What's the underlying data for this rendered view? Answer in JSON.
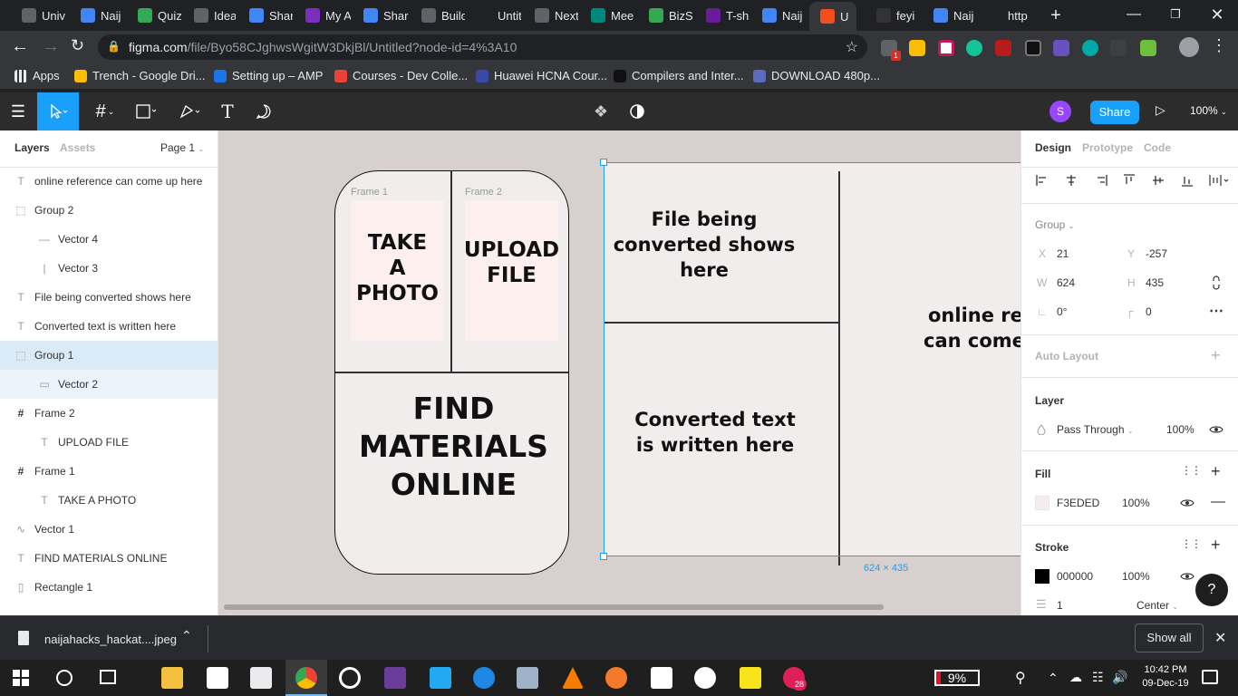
{
  "browser": {
    "tabs": [
      {
        "label": "Univ",
        "color": "#5f6368"
      },
      {
        "label": "Naij",
        "color": "#4285f4"
      },
      {
        "label": "Quiz",
        "color": "#34a853"
      },
      {
        "label": "Idea",
        "color": "#5f6368"
      },
      {
        "label": "Shar",
        "color": "#4285f4"
      },
      {
        "label": "My A",
        "color": "#7b2fbe"
      },
      {
        "label": "Shar",
        "color": "#4285f4"
      },
      {
        "label": "Build",
        "color": "#5f6368"
      },
      {
        "label": "Untit",
        "color": "#202124"
      },
      {
        "label": "Next",
        "color": "#5f6368"
      },
      {
        "label": "Mee",
        "color": "#00897b"
      },
      {
        "label": "BizS",
        "color": "#34a853"
      },
      {
        "label": "T-sh",
        "color": "#6a1b9a"
      },
      {
        "label": "Naij",
        "color": "#4285f4"
      },
      {
        "label": "U",
        "color": "#f24e1e"
      },
      {
        "label": "feyi",
        "color": "#333"
      },
      {
        "label": "Naij",
        "color": "#4285f4"
      },
      {
        "label": "",
        "color": "#202124"
      },
      {
        "label": "http",
        "color": "#202124"
      }
    ],
    "url_host": "figma.com",
    "url_path": "/file/Byo58CJghwsWgitW3DkjBl/Untitled?node-id=4%3A10",
    "bookmarks": [
      {
        "label": "Apps",
        "color": "#e8eaed"
      },
      {
        "label": "Trench - Google Dri...",
        "color": "#fbbc04"
      },
      {
        "label": "Setting up – AMP",
        "color": "#1a73e8"
      },
      {
        "label": "Courses - Dev Colle...",
        "color": "#ea4335"
      },
      {
        "label": "Huawei HCNA Cour...",
        "color": "#3949ab"
      },
      {
        "label": "Compilers and Inter...",
        "color": "#111"
      },
      {
        "label": "DOWNLOAD 480p...",
        "color": "#5c6bc0"
      }
    ],
    "ext_badge": "1"
  },
  "figma": {
    "avatar_letter": "S",
    "share_label": "Share",
    "zoom": "100%",
    "layers_tab": "Layers",
    "assets_tab": "Assets",
    "page_label": "Page 1",
    "layers": [
      {
        "label": "online reference can come up here",
        "icon": "T",
        "indent": 0
      },
      {
        "label": "Group 2",
        "icon": "⬚",
        "indent": 0
      },
      {
        "label": "Vector 4",
        "icon": "—",
        "indent": 1
      },
      {
        "label": "Vector 3",
        "icon": "|",
        "indent": 1
      },
      {
        "label": "File being converted shows here",
        "icon": "T",
        "indent": 0
      },
      {
        "label": "Converted text is written here",
        "icon": "T",
        "indent": 0
      },
      {
        "label": "Group 1",
        "icon": "⬚",
        "indent": 0
      },
      {
        "label": "Vector 2",
        "icon": "▭",
        "indent": 1
      },
      {
        "label": "Frame 2",
        "icon": "#",
        "indent": 0
      },
      {
        "label": "UPLOAD FILE",
        "icon": "T",
        "indent": 1
      },
      {
        "label": "Frame 1",
        "icon": "#",
        "indent": 0
      },
      {
        "label": "TAKE A PHOTO",
        "icon": "T",
        "indent": 1
      },
      {
        "label": "Vector 1",
        "icon": "∿",
        "indent": 0
      },
      {
        "label": "FIND MATERIALS ONLINE",
        "icon": "T",
        "indent": 0
      },
      {
        "label": "Rectangle 1",
        "icon": "▯",
        "indent": 0
      }
    ],
    "canvas": {
      "frame1_label": "Frame 1",
      "frame2_label": "Frame 2",
      "take_photo": [
        "TAKE",
        "A",
        "PHOTO"
      ],
      "upload_file": [
        "UPLOAD",
        "FILE"
      ],
      "find_materials": [
        "FIND",
        "MATERIALS",
        "ONLINE"
      ],
      "file_converted": [
        "File being",
        "converted shows",
        "here"
      ],
      "converted_text": [
        "Converted text",
        "is written here"
      ],
      "online_ref": [
        "online ref",
        "can come"
      ],
      "dimension": "624 × 435"
    },
    "design": {
      "tabs": [
        "Design",
        "Prototype",
        "Code"
      ],
      "group_label": "Group",
      "x_label": "X",
      "x_value": "21",
      "y_label": "Y",
      "y_value": "-257",
      "w_label": "W",
      "w_value": "624",
      "h_label": "H",
      "h_value": "435",
      "rotation": "0°",
      "radius": "0",
      "auto_layout": "Auto Layout",
      "layer_title": "Layer",
      "blend_mode": "Pass Through",
      "layer_opacity": "100%",
      "fill_title": "Fill",
      "fill_hex": "F3EDED",
      "fill_color": "#F3EDED",
      "fill_opacity": "100%",
      "stroke_title": "Stroke",
      "stroke_hex": "000000",
      "stroke_color": "#000000",
      "stroke_opacity": "100%",
      "stroke_weight": "1",
      "stroke_align": "Center",
      "help": "?"
    }
  },
  "downloads": {
    "file_name": "naijahacks_hackat....jpeg",
    "show_all": "Show all"
  },
  "taskbar": {
    "battery": "9%",
    "time": "10:42 PM",
    "date": "09-Dec-19",
    "notif_badge": "28"
  }
}
